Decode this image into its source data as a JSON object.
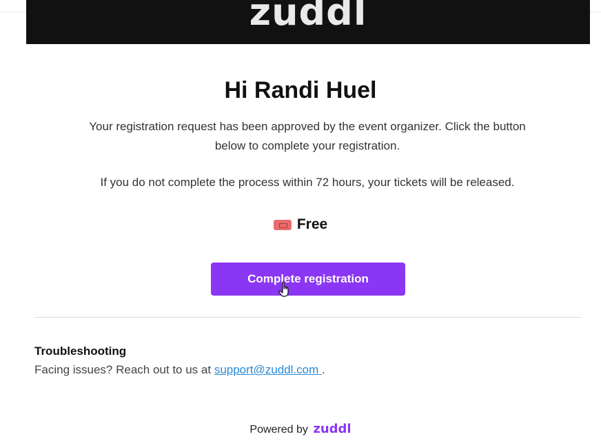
{
  "banner": {
    "logo_text": "zuddl"
  },
  "email": {
    "greeting": "Hi Randi Huel",
    "paragraph_1": "Your registration request has been approved by the event organizer. Click the button below to complete your registration.",
    "paragraph_2": "If you do not complete the process within 72 hours, your tickets will be released.",
    "ticket": {
      "icon": "ticket-icon",
      "label": "Free"
    },
    "cta_label": "Complete registration",
    "troubleshooting": {
      "title": "Troubleshooting",
      "text_prefix": "Facing issues? Reach out to us at ",
      "email_link": "support@zuddl.com ",
      "text_suffix": "."
    }
  },
  "footer": {
    "powered_by": "Powered by",
    "logo_text": "zuddl"
  },
  "colors": {
    "accent": "#8a36f2",
    "banner_bg": "#111111",
    "link": "#2a8bd6"
  }
}
